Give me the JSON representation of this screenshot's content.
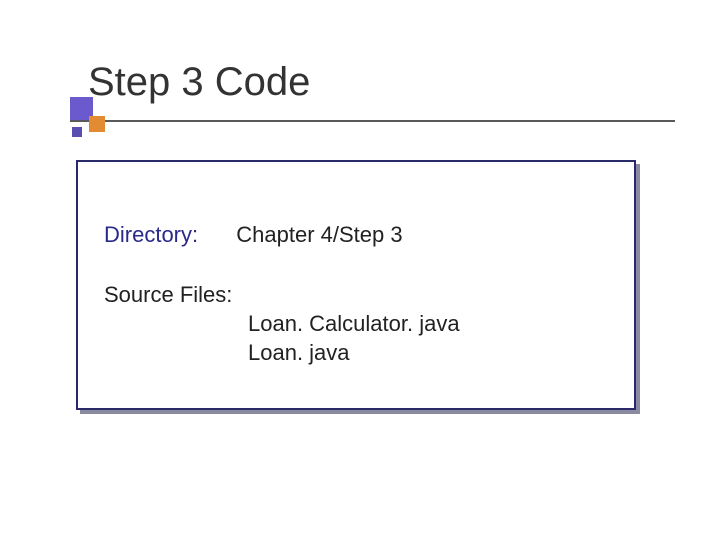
{
  "title": "Step 3 Code",
  "directory_label": "Directory:",
  "directory_value": "Chapter 4/Step 3",
  "source_files_label": "Source Files:",
  "source_files": {
    "file1": "Loan. Calculator. java",
    "file2": "Loan. java"
  }
}
